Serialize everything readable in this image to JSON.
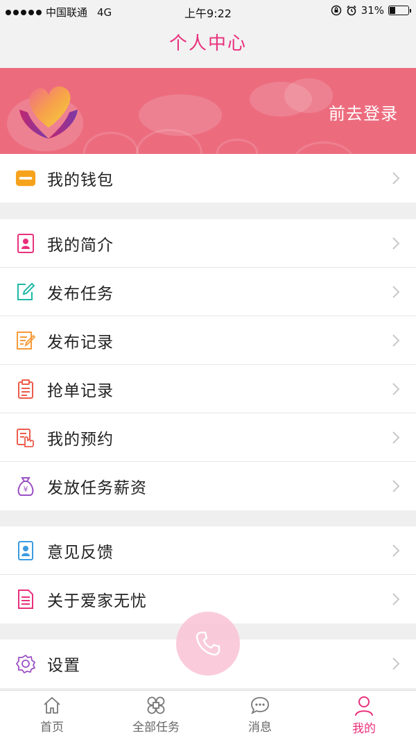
{
  "status_bar": {
    "carrier": "中国联通",
    "network": "4G",
    "time": "上午9:22",
    "battery": "31%",
    "battery_level": 0.31
  },
  "header": {
    "title": "个人中心"
  },
  "banner": {
    "login_label": "前去登录",
    "bg_color": "#ec6c7e"
  },
  "menu": {
    "wallet": {
      "label": "我的钱包",
      "icon": "wallet-icon"
    },
    "profile": {
      "label": "我的简介",
      "icon": "profile-card-icon"
    },
    "publish_task": {
      "label": "发布任务",
      "icon": "edit-icon"
    },
    "publish_records": {
      "label": "发布记录",
      "icon": "note-icon"
    },
    "grab_records": {
      "label": "抢单记录",
      "icon": "clipboard-icon"
    },
    "appointments": {
      "label": "我的预约",
      "icon": "hand-document-icon"
    },
    "pay_salary": {
      "label": "发放任务薪资",
      "icon": "money-bag-icon"
    },
    "feedback": {
      "label": "意见反馈",
      "icon": "feedback-icon"
    },
    "about": {
      "label": "关于爱家无忧",
      "icon": "document-icon"
    },
    "settings": {
      "label": "设置",
      "icon": "gear-icon"
    }
  },
  "tabbar": {
    "home": "首页",
    "all_tasks": "全部任务",
    "messages": "消息",
    "mine": "我的"
  },
  "colors": {
    "accent": "#e9307c"
  }
}
